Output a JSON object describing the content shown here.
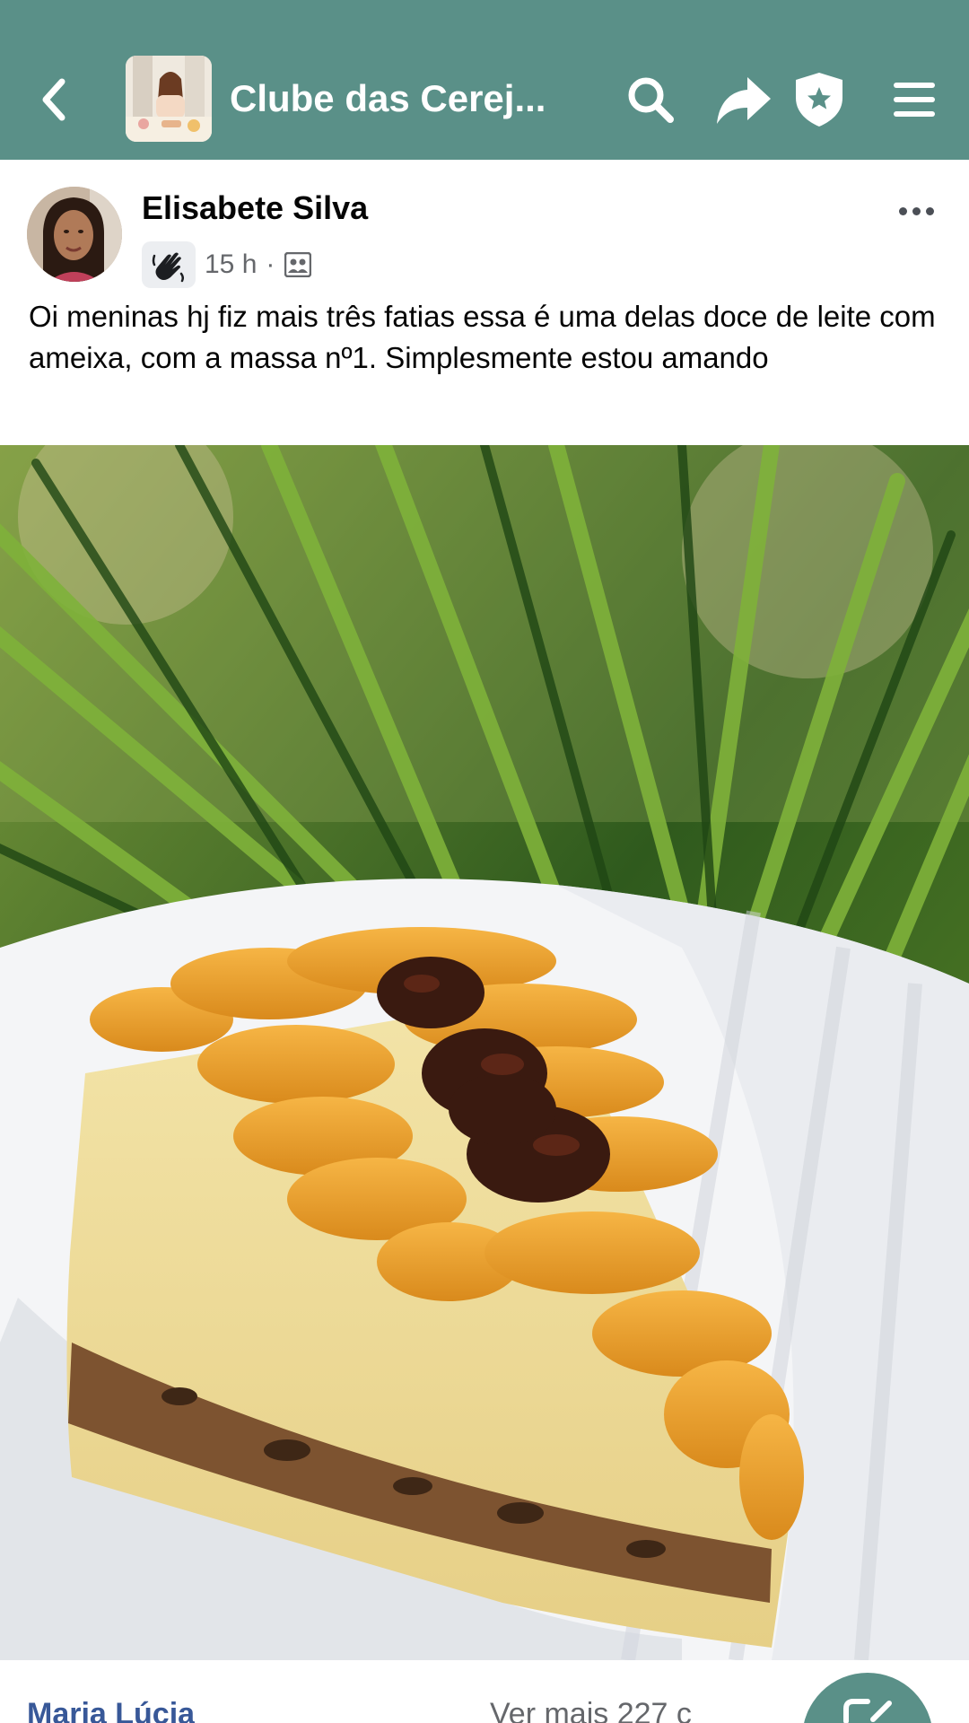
{
  "topbar": {
    "group_title": "Clube das Cerej...",
    "icons": {
      "back": "chevron-left-icon",
      "search": "search-icon",
      "share": "share-arrow-icon",
      "admin": "shield-star-icon",
      "menu": "hamburger-menu-icon"
    },
    "bar_color": "#5a9088"
  },
  "post": {
    "author": "Elisabete Silva",
    "time": "15 h",
    "separator": "·",
    "badge_icon": "waving-hand-icon",
    "privacy_icon": "group-members-icon",
    "text": "Oi meninas hj fiz mais três fatias essa é uma delas doce de leite com ameixa, com a massa nº1. Simplesmente estou amando",
    "more_icon": "more-horizontal-icon"
  },
  "footer": {
    "reactors": "Maria Lúcia",
    "comments": "Ver mais 227 c",
    "fab_icon": "compose-icon"
  }
}
